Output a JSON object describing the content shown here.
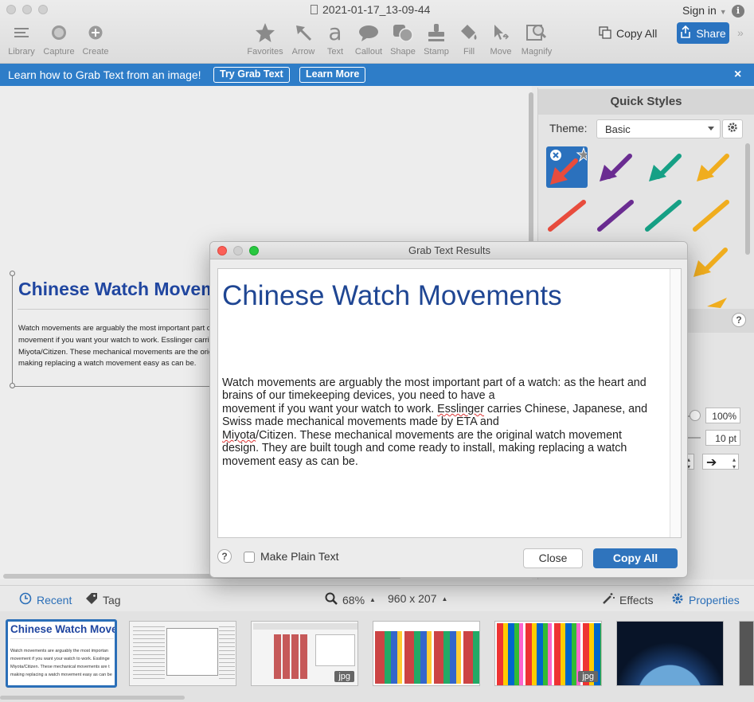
{
  "window": {
    "title": "2021-01-17_13-09-44",
    "signin": "Sign in"
  },
  "toolbar": {
    "left": [
      {
        "label": "Library",
        "icon": "library-icon"
      },
      {
        "label": "Capture",
        "icon": "capture-icon"
      },
      {
        "label": "Create",
        "icon": "create-icon"
      }
    ],
    "tools": [
      {
        "label": "Favorites"
      },
      {
        "label": "Arrow"
      },
      {
        "label": "Text"
      },
      {
        "label": "Callout"
      },
      {
        "label": "Shape"
      },
      {
        "label": "Stamp"
      },
      {
        "label": "Fill"
      },
      {
        "label": "Move"
      },
      {
        "label": "Magnify"
      }
    ],
    "copy_all": "Copy All",
    "share": "Share"
  },
  "banner": {
    "message": "Learn how to Grab Text from an image!",
    "try_button": "Try Grab Text",
    "learn_button": "Learn More",
    "close": "×"
  },
  "capture": {
    "title": "Chinese Watch Movements",
    "lines": [
      "Watch movements are arguably the most important part of a watch",
      "movement if you want your watch to work. Esslinger carries Chinese,",
      "Miyota/Citizen. These mechanical movements are the original watch",
      "making replacing a watch movement easy as can be."
    ]
  },
  "quick_styles": {
    "title": "Quick Styles",
    "theme_label": "Theme:",
    "theme_value": "Basic"
  },
  "properties": {
    "opacity": "100%",
    "width": "10 pt"
  },
  "dialog": {
    "title": "Grab Text Results",
    "heading": "Chinese Watch Movements",
    "lines": [
      "Watch movements are arguably the most important part of a watch: as the heart and",
      "brains of our timekeeping devices, you need to have a",
      "movement if you want your watch to work. ",
      "Swiss made mechanical movements made by ETA and",
      "",
      "design. They are built tough and come ready to install, making replacing a watch",
      "movement easy as can be."
    ],
    "esslinger_pre": "movement if you want your watch to work. ",
    "esslinger": "Esslinger",
    "esslinger_post": " carries Chinese, Japanese, and",
    "miyota": "Miyota",
    "miyota_post": "/Citizen. These mechanical movements are the original watch movement",
    "help": "?",
    "plain_text": "Make Plain Text",
    "close": "Close",
    "copy_all": "Copy All"
  },
  "bottom": {
    "recent": "Recent",
    "tag": "Tag",
    "zoom": "68%",
    "size": "960 x 207",
    "effects": "Effects",
    "properties": "Properties"
  },
  "tray": {
    "thumb1_title": "Chinese Watch Move",
    "thumb1_lines": [
      "Watch movements are arguably the most importan",
      "movement if you want your watch to work. Esslinge",
      "Miyota/Citizen. These mechanical movements are t",
      "making replacing a watch movement easy as can be"
    ],
    "badge": "jpg"
  },
  "colors": {
    "accent": "#2e7dc8",
    "heading": "#1f4693"
  }
}
